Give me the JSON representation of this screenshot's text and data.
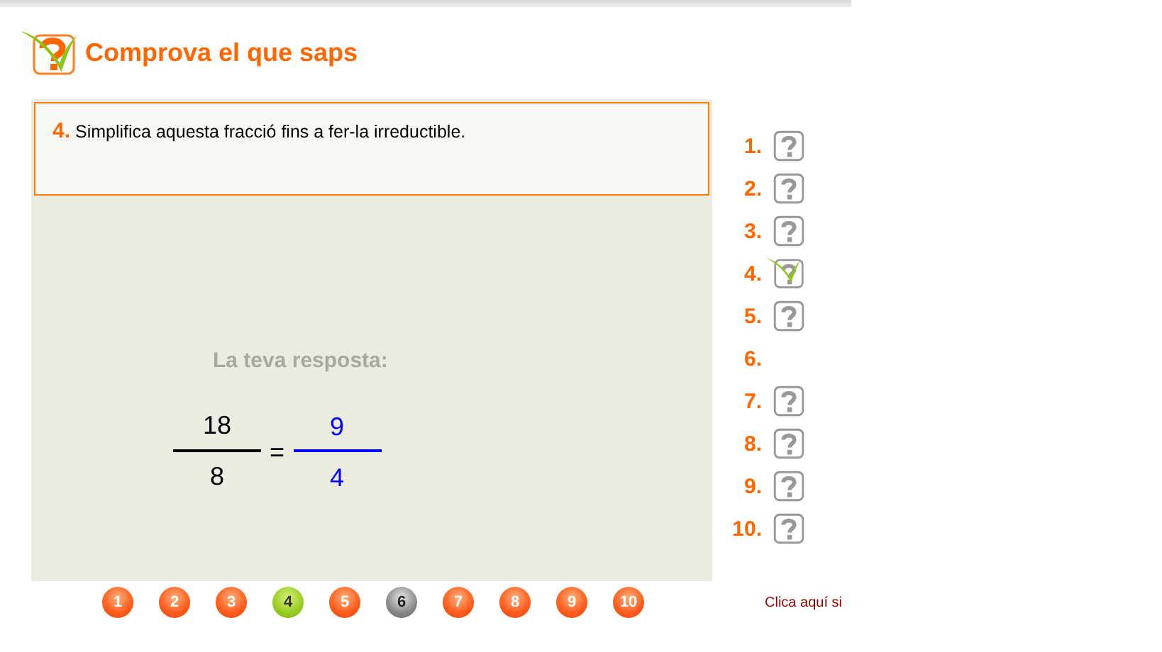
{
  "header": {
    "title": "Comprova el que saps"
  },
  "question": {
    "number": "4.",
    "text": "Simplifica aquesta fracció fins a fer-la irreductible."
  },
  "answer": {
    "prompt": "La teva resposta:",
    "given": {
      "numerator": "18",
      "denominator": "8"
    },
    "equals": "=",
    "response": {
      "numerator": "9",
      "denominator": "4"
    }
  },
  "progress": [
    {
      "label": "1.",
      "kind": "pending"
    },
    {
      "label": "2.",
      "kind": "pending"
    },
    {
      "label": "3.",
      "kind": "pending"
    },
    {
      "label": "4.",
      "kind": "current"
    },
    {
      "label": "5.",
      "kind": "pending"
    },
    {
      "label": "6.",
      "kind": "skipped"
    },
    {
      "label": "7.",
      "kind": "pending"
    },
    {
      "label": "8.",
      "kind": "pending"
    },
    {
      "label": "9.",
      "kind": "pending"
    },
    {
      "label": "10.",
      "kind": "pending"
    }
  ],
  "pager": [
    {
      "label": "1",
      "kind": "pending"
    },
    {
      "label": "2",
      "kind": "pending"
    },
    {
      "label": "3",
      "kind": "pending"
    },
    {
      "label": "4",
      "kind": "current"
    },
    {
      "label": "5",
      "kind": "pending"
    },
    {
      "label": "6",
      "kind": "skipped"
    },
    {
      "label": "7",
      "kind": "pending"
    },
    {
      "label": "8",
      "kind": "pending"
    },
    {
      "label": "9",
      "kind": "pending"
    },
    {
      "label": "10",
      "kind": "pending"
    }
  ],
  "footer_link": "Clica aquí si"
}
